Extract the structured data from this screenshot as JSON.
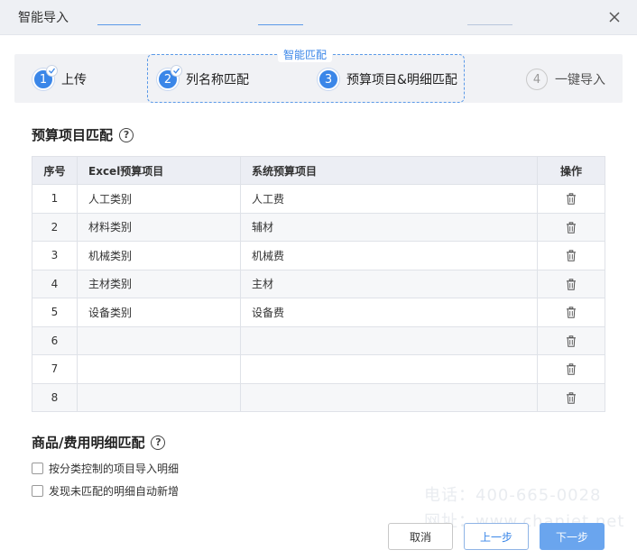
{
  "dialog": {
    "title": "智能导入"
  },
  "steps": [
    {
      "number": "1",
      "label": "上传",
      "state": "done"
    },
    {
      "number": "2",
      "label": "列名称匹配",
      "state": "done"
    },
    {
      "number": "3",
      "label": "预算项目&明细匹配",
      "state": "active"
    },
    {
      "number": "4",
      "label": "一键导入",
      "state": "pending"
    }
  ],
  "smart_match_tag": "智能匹配",
  "budget_section": {
    "title": "预算项目匹配",
    "columns": [
      "序号",
      "Excel预算项目",
      "系统预算项目",
      "操作"
    ],
    "rows": [
      {
        "index": "1",
        "excel": "人工类别",
        "system": "人工费"
      },
      {
        "index": "2",
        "excel": "材料类别",
        "system": "辅材"
      },
      {
        "index": "3",
        "excel": "机械类别",
        "system": "机械费"
      },
      {
        "index": "4",
        "excel": "主材类别",
        "system": "主材"
      },
      {
        "index": "5",
        "excel": "设备类别",
        "system": "设备费"
      },
      {
        "index": "6",
        "excel": "",
        "system": ""
      },
      {
        "index": "7",
        "excel": "",
        "system": ""
      },
      {
        "index": "8",
        "excel": "",
        "system": ""
      }
    ]
  },
  "detail_section": {
    "title": "商品/费用明细匹配",
    "options": [
      {
        "label": "按分类控制的项目导入明细",
        "checked": false
      },
      {
        "label": "发现未匹配的明细自动新增",
        "checked": false
      }
    ]
  },
  "watermark": {
    "phone": "电话：400-665-0028",
    "site": "网址：www.chanjet.net"
  },
  "buttons": {
    "cancel": "取消",
    "prev": "上一步",
    "next": "下一步"
  },
  "icons": {
    "close": "close-icon",
    "help": "question-circle-icon",
    "delete": "trash-icon",
    "check": "check-icon"
  },
  "colors": {
    "primary": "#3a86e8",
    "primary_light": "#6aa5ee",
    "header_bg": "#eef0f4"
  }
}
